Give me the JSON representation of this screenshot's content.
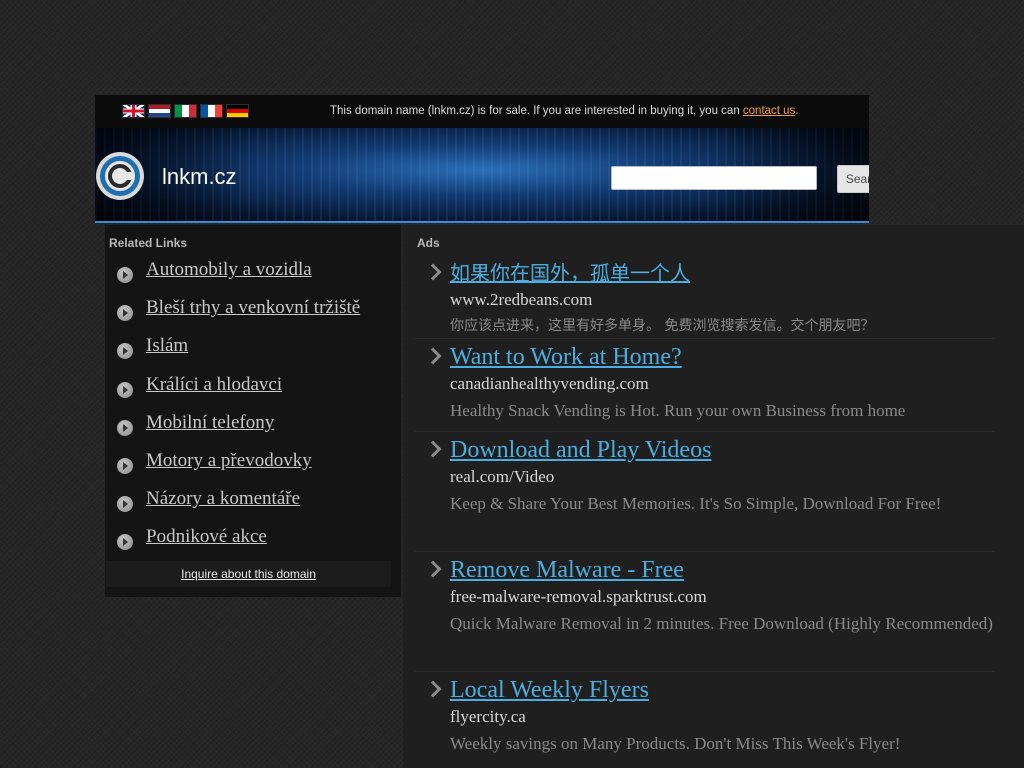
{
  "topbar": {
    "sale_text": "This domain name (lnkm.cz) is for sale. If you are interested in buying it, you can ",
    "contact_label": "contact us",
    "sale_suffix": "."
  },
  "header": {
    "site_name": "lnkm.cz",
    "search_button": "Search Ads"
  },
  "related": {
    "title": "Related Links",
    "items": [
      "Automobily a vozidla",
      "Bleší trhy a venkovní tržiště",
      "Islám",
      "Králíci a hlodavci",
      "Mobilní telefony",
      "Motory a převodovky",
      "Názory a komentáře",
      "Podnikové akce"
    ],
    "inquire": "Inquire about this domain"
  },
  "ads": {
    "title": "Ads",
    "items": [
      {
        "title": "如果你在国外，孤单一个人",
        "url": "www.2redbeans.com",
        "desc": "你应该点进来，这里有好多单身。 免费浏览搜索发信。交个朋友吧？"
      },
      {
        "title": "Want to Work at Home?",
        "url": "canadianhealthyvending.com",
        "desc": "Healthy Snack Vending is Hot. Run your own Business from home"
      },
      {
        "title": "Download and Play Videos",
        "url": "real.com/Video",
        "desc": "Keep & Share Your Best Memories. It's So Simple, Download For Free!"
      },
      {
        "title": "Remove Malware - Free",
        "url": "free-malware-removal.sparktrust.com",
        "desc": "Quick Malware Removal in 2 minutes. Free Download (Highly Recommended)"
      },
      {
        "title": "Local Weekly Flyers",
        "url": "flyercity.ca",
        "desc": "Weekly savings on Many Products. Don't Miss This Week's Flyer!"
      }
    ]
  }
}
